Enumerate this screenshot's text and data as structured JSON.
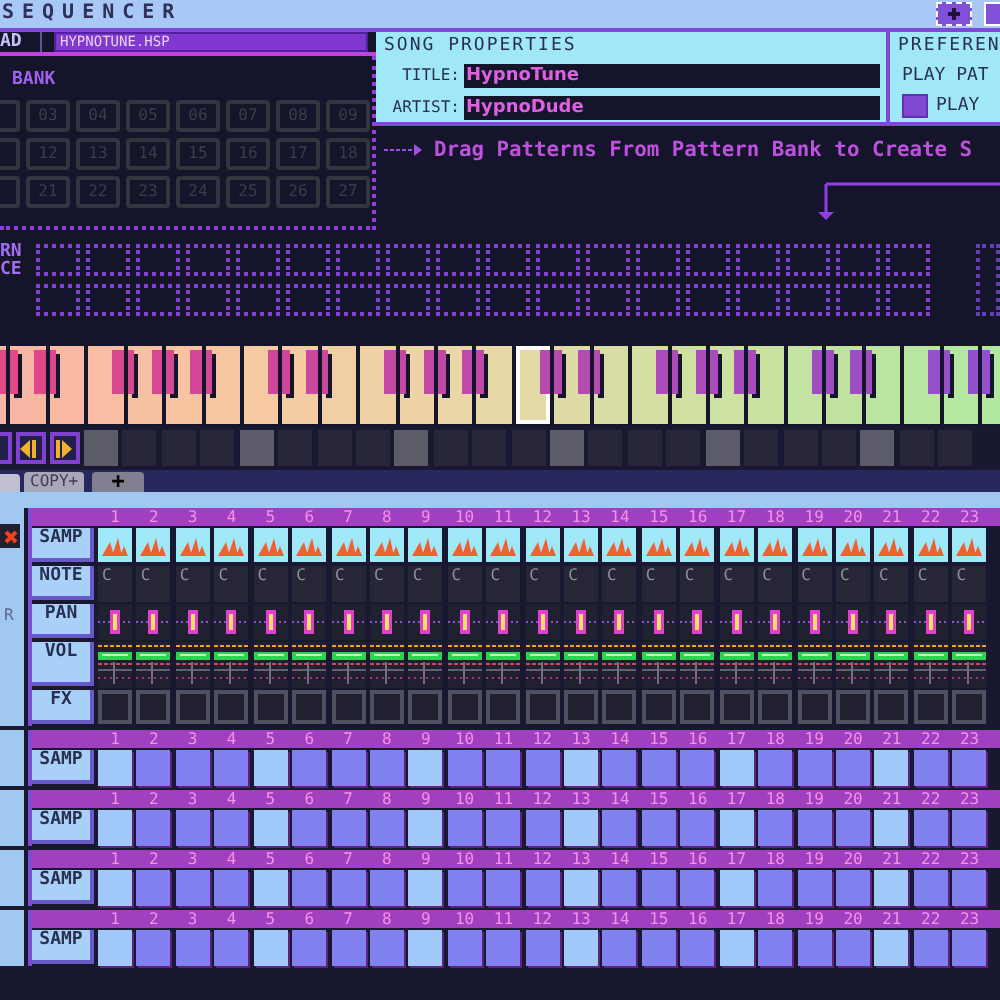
{
  "window": {
    "title": "SEQUENCER"
  },
  "file": {
    "label": "AD",
    "value": "HYPNOTUNE.HSP"
  },
  "song_properties": {
    "heading": "SONG PROPERTIES",
    "fields": [
      {
        "label": "TITLE:",
        "value": "HypnoTune"
      },
      {
        "label": "ARTIST:",
        "value": "HypnoDude"
      }
    ]
  },
  "preferences": {
    "heading": "PREFEREN",
    "option": "PLAY PAT",
    "checkbox": {
      "label": "PLAY",
      "checked": true
    }
  },
  "pattern_bank": {
    "label": "BANK",
    "rows": [
      [
        "03",
        "04",
        "05",
        "06",
        "07",
        "08",
        "09"
      ],
      [
        "12",
        "13",
        "14",
        "15",
        "16",
        "17",
        "18"
      ],
      [
        "21",
        "22",
        "23",
        "24",
        "25",
        "26",
        "27"
      ]
    ]
  },
  "hint": "Drag Patterns From Pattern Bank to Create S",
  "sequence": {
    "label": [
      "RN",
      "CE"
    ]
  },
  "keys": [
    {
      "selected": false
    },
    {
      "selected": false
    },
    {
      "selected": false
    },
    {
      "selected": false
    },
    {
      "selected": false
    },
    {
      "selected": false
    },
    {
      "selected": false
    },
    {
      "selected": false
    },
    {
      "selected": false
    },
    {
      "selected": false
    },
    {
      "selected": false
    },
    {
      "selected": false
    },
    {
      "selected": false
    },
    {
      "selected": false
    },
    {
      "selected": true
    },
    {
      "selected": false
    },
    {
      "selected": false
    },
    {
      "selected": false
    },
    {
      "selected": false
    },
    {
      "selected": false
    },
    {
      "selected": false
    },
    {
      "selected": false
    },
    {
      "selected": false
    },
    {
      "selected": false
    },
    {
      "selected": false
    },
    {
      "selected": false
    },
    {
      "selected": false
    }
  ],
  "steps": [
    true,
    false,
    false,
    false,
    true,
    false,
    false,
    false,
    true,
    false,
    false,
    false,
    true,
    false,
    false,
    false,
    true,
    false,
    false,
    false,
    true,
    false,
    false
  ],
  "tabs": [
    {
      "label": "COPY+",
      "kind": "tab"
    },
    {
      "label": "+",
      "kind": "add"
    }
  ],
  "channels": [
    {
      "close_button": true,
      "side_text": "R",
      "step_numbers": [
        "1",
        "2",
        "3",
        "4",
        "5",
        "6",
        "7",
        "8",
        "9",
        "10",
        "11",
        "12",
        "13",
        "14",
        "15",
        "16",
        "17",
        "18",
        "19",
        "20",
        "21",
        "22",
        "23"
      ],
      "rows": [
        {
          "label": "SAMP",
          "kind": "sample"
        },
        {
          "label": "NOTE",
          "kind": "note",
          "notes": [
            "C",
            "C",
            "C",
            "C",
            "C",
            "C",
            "C",
            "C",
            "C",
            "C",
            "C",
            "C",
            "C",
            "C",
            "C",
            "C",
            "C",
            "C",
            "C",
            "C",
            "C",
            "C",
            "C"
          ]
        },
        {
          "label": "PAN",
          "kind": "pan",
          "cells": [
            {
              "level": 0.5
            },
            {
              "level": 0.5
            },
            {
              "level": 0.5
            },
            {
              "level": 0.5
            },
            {
              "level": 0.5
            },
            {
              "level": 0.5
            },
            {
              "level": 0.5
            },
            {
              "level": 0.5
            },
            {
              "level": 0.5
            },
            {
              "level": 0.5
            },
            {
              "level": 0.5
            },
            {
              "level": 0.5
            },
            {
              "level": 0.5
            },
            {
              "level": 0.5
            },
            {
              "level": 0.5
            },
            {
              "level": 0.5
            },
            {
              "level": 0.5
            },
            {
              "level": 0.5
            },
            {
              "level": 0.5
            },
            {
              "level": 0.5
            },
            {
              "level": 0.5
            },
            {
              "level": 0.5
            },
            {
              "level": 0.5
            }
          ]
        },
        {
          "label": "VOL",
          "kind": "volume"
        },
        {
          "label": "FX",
          "kind": "fx"
        }
      ]
    },
    {
      "close_button": false,
      "step_numbers": [
        "1",
        "2",
        "3",
        "4",
        "5",
        "6",
        "7",
        "8",
        "9",
        "10",
        "11",
        "12",
        "13",
        "14",
        "15",
        "16",
        "17",
        "18",
        "19",
        "20",
        "21",
        "22",
        "23"
      ],
      "rows": [
        {
          "label": "SAMP",
          "kind": "steps",
          "accent": [
            true,
            false,
            false,
            false,
            true,
            false,
            false,
            false,
            true,
            false,
            false,
            false,
            true,
            false,
            false,
            false,
            true,
            false,
            false,
            false,
            true,
            false,
            false
          ]
        }
      ]
    },
    {
      "close_button": false,
      "step_numbers": [
        "1",
        "2",
        "3",
        "4",
        "5",
        "6",
        "7",
        "8",
        "9",
        "10",
        "11",
        "12",
        "13",
        "14",
        "15",
        "16",
        "17",
        "18",
        "19",
        "20",
        "21",
        "22",
        "23"
      ],
      "rows": [
        {
          "label": "SAMP",
          "kind": "steps",
          "accent": [
            true,
            false,
            false,
            false,
            true,
            false,
            false,
            false,
            true,
            false,
            false,
            false,
            true,
            false,
            false,
            false,
            true,
            false,
            false,
            false,
            true,
            false,
            false
          ]
        }
      ]
    },
    {
      "close_button": false,
      "step_numbers": [
        "1",
        "2",
        "3",
        "4",
        "5",
        "6",
        "7",
        "8",
        "9",
        "10",
        "11",
        "12",
        "13",
        "14",
        "15",
        "16",
        "17",
        "18",
        "19",
        "20",
        "21",
        "22",
        "23"
      ],
      "rows": [
        {
          "label": "SAMP",
          "kind": "steps",
          "accent": [
            true,
            false,
            false,
            false,
            true,
            false,
            false,
            false,
            true,
            false,
            false,
            false,
            true,
            false,
            false,
            false,
            true,
            false,
            false,
            false,
            true,
            false,
            false
          ]
        }
      ]
    },
    {
      "close_button": false,
      "step_numbers": [
        "1",
        "2",
        "3",
        "4",
        "5",
        "6",
        "7",
        "8",
        "9",
        "10",
        "11",
        "12",
        "13",
        "14",
        "15",
        "16",
        "17",
        "18",
        "19",
        "20",
        "21",
        "22",
        "23"
      ],
      "rows": [
        {
          "label": "SAMP",
          "kind": "steps",
          "accent": [
            true,
            false,
            false,
            false,
            true,
            false,
            false,
            false,
            true,
            false,
            false,
            false,
            true,
            false,
            false,
            false,
            true,
            false,
            false,
            false,
            true,
            false,
            false
          ]
        }
      ]
    }
  ]
}
